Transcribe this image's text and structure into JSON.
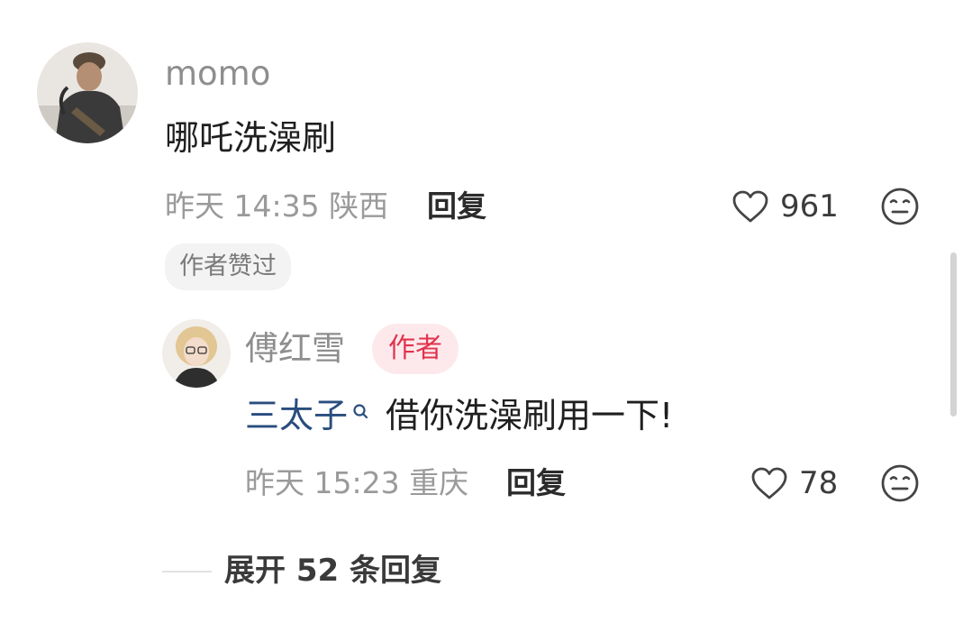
{
  "comment": {
    "username": "momo",
    "text": "哪吒洗澡刷",
    "time": "昨天 14:35",
    "location": "陕西",
    "reply_label": "回复",
    "like_count": "961",
    "author_liked_label": "作者赞过"
  },
  "reply": {
    "username": "傅红雪",
    "author_badge": "作者",
    "mention": "三太子",
    "mention_icon": "search-hint-icon",
    "text": "借你洗澡刷用一下!",
    "time": "昨天 15:23",
    "location": "重庆",
    "reply_label": "回复",
    "like_count": "78"
  },
  "expand_label": "展开 52 条回复",
  "icons": {
    "like": "heart-outline-icon",
    "dislike": "meh-face-icon"
  },
  "colors": {
    "author_badge_bg": "#fde9ec",
    "author_badge_text": "#e1334d",
    "mention": "#2a4d7e"
  }
}
